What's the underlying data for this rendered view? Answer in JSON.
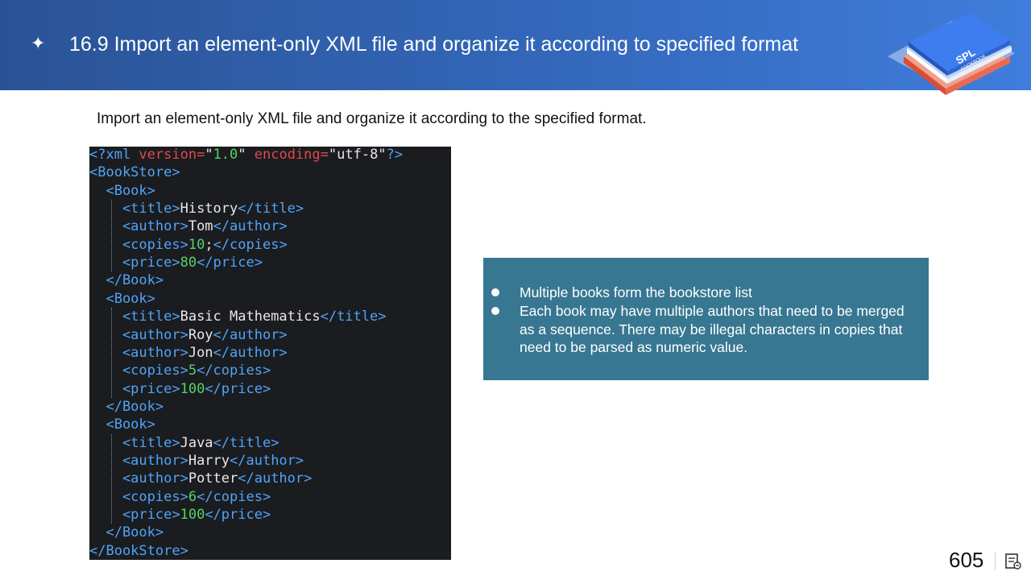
{
  "header": {
    "bullet_glyph": "✦",
    "title": "16.9 Import an element-only XML file and organize it according to specified format",
    "logo": {
      "icon": "book-stack-logo",
      "text_top": "SPL",
      "text_bottom": "COOKBOOK"
    }
  },
  "intro": "Import an element-only XML file and organize it according to the specified format.",
  "code": {
    "lines": [
      [
        {
          "t": "<?xml ",
          "c": "tag"
        },
        {
          "t": "version=",
          "c": "attr"
        },
        {
          "t": "\"",
          "c": "str"
        },
        {
          "t": "1.0",
          "c": "num"
        },
        {
          "t": "\" ",
          "c": "str"
        },
        {
          "t": "encoding=",
          "c": "attr"
        },
        {
          "t": "\"utf-8\"",
          "c": "str"
        },
        {
          "t": "?>",
          "c": "tag"
        }
      ],
      [
        {
          "t": "<BookStore>",
          "c": "tag"
        }
      ],
      [
        {
          "t": "  <Book>",
          "c": "tag"
        }
      ],
      [
        {
          "t": "    <title>",
          "c": "tag"
        },
        {
          "t": "History",
          "c": "txt"
        },
        {
          "t": "</title>",
          "c": "tag"
        }
      ],
      [
        {
          "t": "    <author>",
          "c": "tag"
        },
        {
          "t": "Tom",
          "c": "txt"
        },
        {
          "t": "</author>",
          "c": "tag"
        }
      ],
      [
        {
          "t": "    <copies>",
          "c": "tag"
        },
        {
          "t": "10",
          "c": "num"
        },
        {
          "t": ";",
          "c": "txt"
        },
        {
          "t": "</copies>",
          "c": "tag"
        }
      ],
      [
        {
          "t": "    <price>",
          "c": "tag"
        },
        {
          "t": "80",
          "c": "num"
        },
        {
          "t": "</price>",
          "c": "tag"
        }
      ],
      [
        {
          "t": "  </Book>",
          "c": "tag"
        }
      ],
      [
        {
          "t": "  <Book>",
          "c": "tag"
        }
      ],
      [
        {
          "t": "    <title>",
          "c": "tag"
        },
        {
          "t": "Basic Mathematics",
          "c": "txt"
        },
        {
          "t": "</title>",
          "c": "tag"
        }
      ],
      [
        {
          "t": "    <author>",
          "c": "tag"
        },
        {
          "t": "Roy",
          "c": "txt"
        },
        {
          "t": "</author>",
          "c": "tag"
        }
      ],
      [
        {
          "t": "    <author>",
          "c": "tag"
        },
        {
          "t": "Jon",
          "c": "txt"
        },
        {
          "t": "</author>",
          "c": "tag"
        }
      ],
      [
        {
          "t": "    <copies>",
          "c": "tag"
        },
        {
          "t": "5",
          "c": "num"
        },
        {
          "t": "</copies>",
          "c": "tag"
        }
      ],
      [
        {
          "t": "    <price>",
          "c": "tag"
        },
        {
          "t": "100",
          "c": "num"
        },
        {
          "t": "</price>",
          "c": "tag"
        }
      ],
      [
        {
          "t": "  </Book>",
          "c": "tag"
        }
      ],
      [
        {
          "t": "  <Book>",
          "c": "tag"
        }
      ],
      [
        {
          "t": "    <title>",
          "c": "tag"
        },
        {
          "t": "Java",
          "c": "txt"
        },
        {
          "t": "</title>",
          "c": "tag"
        }
      ],
      [
        {
          "t": "    <author>",
          "c": "tag"
        },
        {
          "t": "Harry",
          "c": "txt"
        },
        {
          "t": "</author>",
          "c": "tag"
        }
      ],
      [
        {
          "t": "    <author>",
          "c": "tag"
        },
        {
          "t": "Potter",
          "c": "txt"
        },
        {
          "t": "</author>",
          "c": "tag"
        }
      ],
      [
        {
          "t": "    <copies>",
          "c": "tag"
        },
        {
          "t": "6",
          "c": "num"
        },
        {
          "t": "</copies>",
          "c": "tag"
        }
      ],
      [
        {
          "t": "    <price>",
          "c": "tag"
        },
        {
          "t": "100",
          "c": "num"
        },
        {
          "t": "</price>",
          "c": "tag"
        }
      ],
      [
        {
          "t": "  </Book>",
          "c": "tag"
        }
      ],
      [
        {
          "t": "</BookStore>",
          "c": "tag"
        }
      ]
    ]
  },
  "info": {
    "bullets": [
      "Multiple books form the bookstore list",
      "Each book may have multiple authors that need to be merged as a sequence. There may be illegal characters in copies that need to be parsed as numeric value."
    ]
  },
  "footer": {
    "page_number": "605",
    "notes_icon": "notes-icon"
  },
  "colors": {
    "header": "#2f5ea8",
    "code_bg": "#1b1c20",
    "info_bg": "#377791",
    "tag": "#4fa4f5",
    "attr": "#e04a4a",
    "number": "#56d364"
  }
}
